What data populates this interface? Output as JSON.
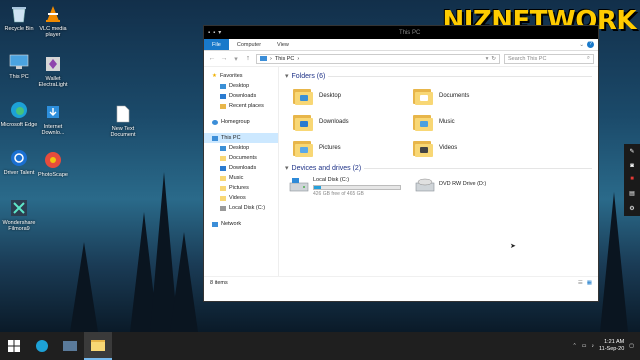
{
  "desktop": {
    "watermark": "NIZNETWORK",
    "icons": [
      {
        "label": "Recycle Bin",
        "icon": "recycle-bin-icon"
      },
      {
        "label": "VLC media player",
        "icon": "vlc-icon"
      },
      {
        "label": "This PC",
        "icon": "this-pc-icon"
      },
      {
        "label": "Wallet ElectraLight",
        "icon": "wallet-icon"
      },
      {
        "label": "Microsoft Edge",
        "icon": "edge-icon"
      },
      {
        "label": "Internet Downlo...",
        "icon": "idm-icon"
      },
      {
        "label": "New Text Document",
        "icon": "text-document-icon"
      },
      {
        "label": "Driver Talent",
        "icon": "driver-talent-icon"
      },
      {
        "label": "PhotoScape",
        "icon": "photoscape-icon"
      },
      {
        "label": "Wondershare Filmora9",
        "icon": "filmora-icon"
      }
    ]
  },
  "window": {
    "title": "This PC",
    "ribbon_tabs": [
      "File",
      "Computer",
      "View"
    ],
    "address": "This PC",
    "search_placeholder": "Search This PC",
    "status": "8 items"
  },
  "nav": {
    "favorites": "Favorites",
    "favorites_items": [
      "Desktop",
      "Downloads",
      "Recent places"
    ],
    "homegroup": "Homegroup",
    "this_pc": "This PC",
    "this_pc_items": [
      "Desktop",
      "Documents",
      "Downloads",
      "Music",
      "Pictures",
      "Videos",
      "Local Disk (C:)"
    ],
    "network": "Network"
  },
  "content": {
    "folders_header": "Folders (6)",
    "folders": [
      {
        "name": "Desktop",
        "badge_color": "#3a8fd6"
      },
      {
        "name": "Documents",
        "badge_color": "#ffffff"
      },
      {
        "name": "Downloads",
        "badge_color": "#2b7bd0"
      },
      {
        "name": "Music",
        "badge_color": "#4aa0e0"
      },
      {
        "name": "Pictures",
        "badge_color": "#5aa8e8"
      },
      {
        "name": "Videos",
        "badge_color": "#444444"
      }
    ],
    "drives_header": "Devices and drives (2)",
    "drives": [
      {
        "name": "Local Disk (C:)",
        "free": "426 GB free of 465 GB",
        "used_fraction": 0.084
      },
      {
        "name": "DVD RW Drive (D:)"
      }
    ]
  },
  "taskbar": {
    "clock_time": "1:21 AM",
    "clock_date": "11-Sep-20"
  },
  "colors": {
    "accent": "#1979ca",
    "folder": "#f8d775",
    "watermark": "#ffcc00"
  }
}
